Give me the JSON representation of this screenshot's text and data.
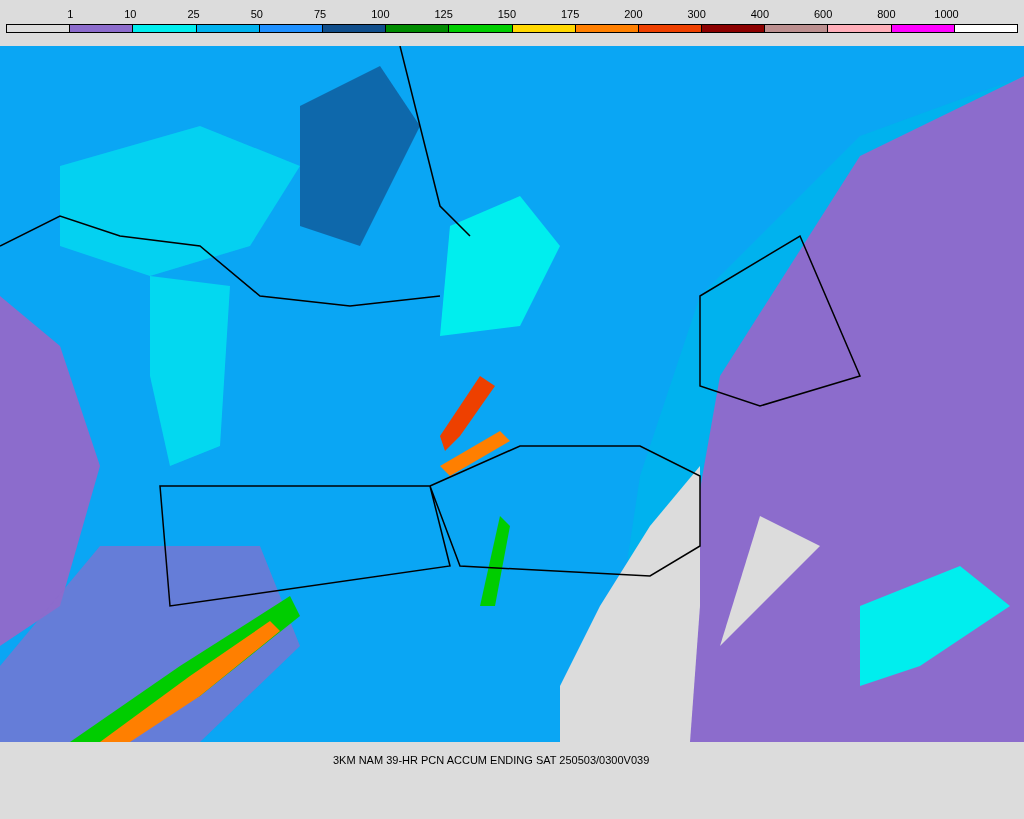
{
  "legend": {
    "labels": [
      "1",
      "10",
      "25",
      "50",
      "75",
      "100",
      "125",
      "150",
      "175",
      "200",
      "300",
      "400",
      "600",
      "800",
      "1000"
    ],
    "swatches": [
      {
        "color": "#dcdcdc"
      },
      {
        "color": "#8c6ccc"
      },
      {
        "color": "#00eeee"
      },
      {
        "color": "#00b2ee"
      },
      {
        "color": "#1e90ff"
      },
      {
        "color": "#104e8b"
      },
      {
        "color": "#008b00"
      },
      {
        "color": "#00cd00"
      },
      {
        "color": "#ffd700"
      },
      {
        "color": "#ff7f00"
      },
      {
        "color": "#ee4000"
      },
      {
        "color": "#8b0000"
      },
      {
        "color": "#bc8f8f"
      },
      {
        "color": "#ffaeb9"
      },
      {
        "color": "#ff00ff"
      },
      {
        "color": "#ffffff"
      }
    ]
  },
  "caption": "3KM NAM 39-HR PCN ACCUM ENDING SAT 250503/0300V039"
}
